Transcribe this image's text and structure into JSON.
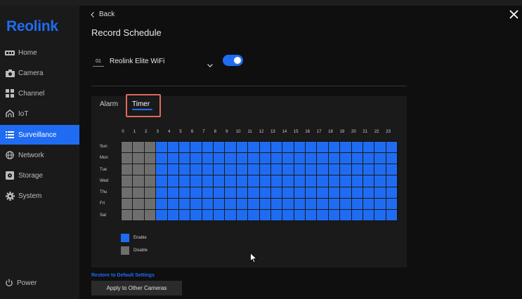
{
  "sidebar": {
    "logo": "Reolink",
    "items": [
      {
        "label": "Home",
        "icon": "home-icon"
      },
      {
        "label": "Camera",
        "icon": "camera-icon"
      },
      {
        "label": "Channel",
        "icon": "channel-icon"
      },
      {
        "label": "IoT",
        "icon": "iot-icon"
      },
      {
        "label": "Surveillance",
        "icon": "list-icon",
        "active": true
      },
      {
        "label": "Network",
        "icon": "globe-icon"
      },
      {
        "label": "Storage",
        "icon": "storage-icon"
      },
      {
        "label": "System",
        "icon": "gear-icon"
      }
    ],
    "power_label": "Power"
  },
  "header": {
    "back_label": "Back",
    "title": "Record Schedule"
  },
  "channel": {
    "number": "01",
    "name": "Reolink Elite WiFi",
    "enabled": true
  },
  "tabs": {
    "alarm": "Alarm",
    "timer": "Timer",
    "active": "timer"
  },
  "schedule": {
    "hours": [
      "0",
      "1",
      "2",
      "3",
      "4",
      "5",
      "6",
      "7",
      "8",
      "9",
      "10",
      "11",
      "12",
      "13",
      "14",
      "15",
      "16",
      "17",
      "18",
      "19",
      "20",
      "21",
      "22",
      "23"
    ],
    "days": [
      "Sun",
      "Mon",
      "Tue",
      "Wed",
      "Thu",
      "Fri",
      "Sat"
    ],
    "disabled_hours": [
      0,
      1,
      2
    ]
  },
  "legend": {
    "enable_label": "Enable",
    "disable_label": "Disable"
  },
  "colors": {
    "accent": "#1f6cf2",
    "disabled_cell": "#6e6e6e",
    "highlight_border": "#e26a5b"
  },
  "footer": {
    "restore_label": "Restore to Default Settings",
    "apply_label": "Apply to Other Cameras"
  }
}
